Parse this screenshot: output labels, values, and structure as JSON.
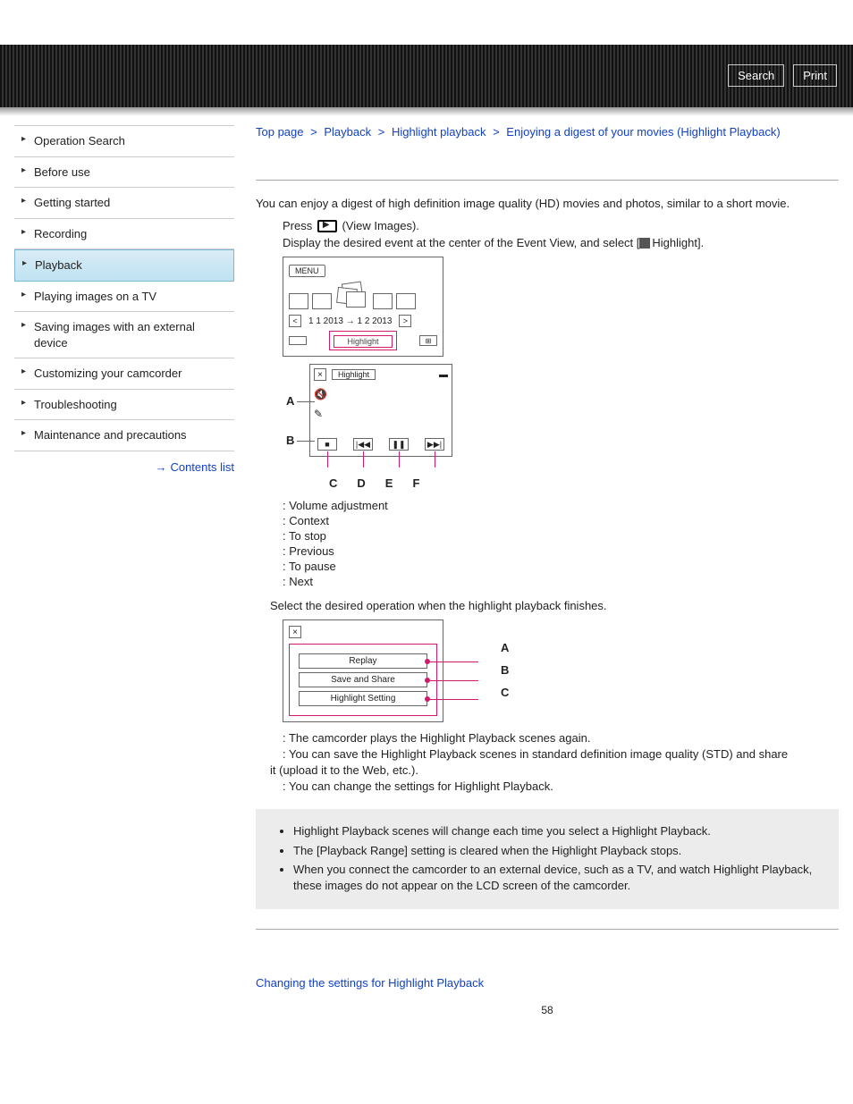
{
  "topbar": {
    "search": "Search",
    "print": "Print"
  },
  "breadcrumb": {
    "top": "Top page",
    "a": "Playback",
    "b": "Highlight playback",
    "c": "Enjoying a digest of your movies (Highlight Playback)"
  },
  "sidebar": {
    "items": [
      {
        "label": "Operation Search"
      },
      {
        "label": "Before use"
      },
      {
        "label": "Getting started"
      },
      {
        "label": "Recording"
      },
      {
        "label": "Playback",
        "active": true
      },
      {
        "label": "Playing images on a TV"
      },
      {
        "label": "Saving images with an external device"
      },
      {
        "label": "Customizing your camcorder"
      },
      {
        "label": "Troubleshooting"
      },
      {
        "label": "Maintenance and precautions"
      }
    ],
    "contents": "Contents list"
  },
  "intro": "You can enjoy a digest of high definition image quality (HD) movies and photos, similar to a short movie.",
  "step1a": "Press ",
  "step1b": " (View Images).",
  "step2a": "Display the desired event at the center of the Event View, and select [",
  "step2b": "Highlight].",
  "fig1": {
    "menu": "MENU",
    "date": "1 1 2013 → 1 2 2013",
    "btn": "Highlight"
  },
  "fig2": {
    "badge": "Highlight",
    "letters": {
      "a": "A",
      "b": "B",
      "c": "C",
      "d": "D",
      "e": "E",
      "f": "F"
    }
  },
  "defs": {
    "a": ": Volume adjustment",
    "b": ": Context",
    "c": ": To stop",
    "d": ": Previous",
    "e": ": To pause",
    "f": ": Next"
  },
  "step3": "Select the desired operation when the highlight playback finishes.",
  "fig3": {
    "opts": [
      "Replay",
      "Save and Share",
      "Highlight Setting"
    ],
    "letters": {
      "a": "A",
      "b": "B",
      "c": "C"
    }
  },
  "expl": {
    "a": ": The camcorder plays the Highlight Playback scenes again.",
    "b": ": You can save the Highlight Playback scenes in standard definition image quality (STD) and share",
    "b2": "it (upload it to the Web, etc.).",
    "c": ": You can change the settings for Highlight Playback."
  },
  "notes": [
    "Highlight Playback scenes will change each time you select a Highlight Playback.",
    "The [Playback Range] setting is cleared when the Highlight Playback stops.",
    "When you connect the camcorder to an external device, such as a TV, and watch Highlight Playback, these images do not appear on the LCD screen of the camcorder."
  ],
  "bottom_link": "Changing the settings for Highlight Playback",
  "page_number": "58"
}
